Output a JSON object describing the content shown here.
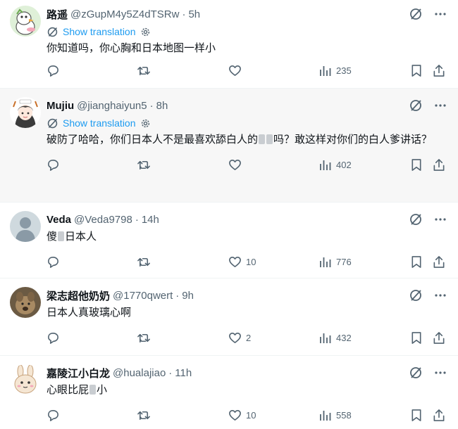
{
  "translation_label": "Show translation",
  "icons": {
    "grok": "grok-icon",
    "more": "more-icon",
    "reply": "reply-icon",
    "retweet": "retweet-icon",
    "like": "like-icon",
    "views": "views-icon",
    "bookmark": "bookmark-icon",
    "share": "share-icon",
    "translate": "translate-icon",
    "settings": "gear-icon"
  },
  "colors": {
    "accent": "#1d9bf0",
    "muted": "#536471",
    "highlight_bg": "#f7f7f7"
  },
  "tweets": [
    {
      "name": "路遥",
      "handle": "@zGupM4y5Z4dTSRw",
      "dot": "·",
      "time": "5h",
      "text": "你知道吗，你心胸和日本地图一样小",
      "likes": "",
      "views": "235"
    },
    {
      "name": "Mujiu",
      "handle": "@jianghaiyun5",
      "dot": "·",
      "time": "8h",
      "text_a": "破防了哈哈，你们日本人不是最喜欢舔白人的",
      "text_b": "吗？敢这样对你们的白人爹讲话？",
      "likes": "",
      "views": "402"
    },
    {
      "name": "Veda",
      "handle": "@Veda9798",
      "dot": "·",
      "time": "14h",
      "text_a": "傻",
      "text_b": "日本人",
      "likes": "10",
      "views": "776"
    },
    {
      "name": "梁志超他奶奶",
      "handle": "@1770qwert",
      "dot": "·",
      "time": "9h",
      "text": "日本人真玻璃心啊",
      "likes": "2",
      "views": "432"
    },
    {
      "name": "嘉陵江小白龙",
      "handle": "@hualajiao",
      "dot": "·",
      "time": "11h",
      "text_a": "心眼比屁",
      "text_b": "小",
      "likes": "10",
      "views": "558"
    }
  ]
}
